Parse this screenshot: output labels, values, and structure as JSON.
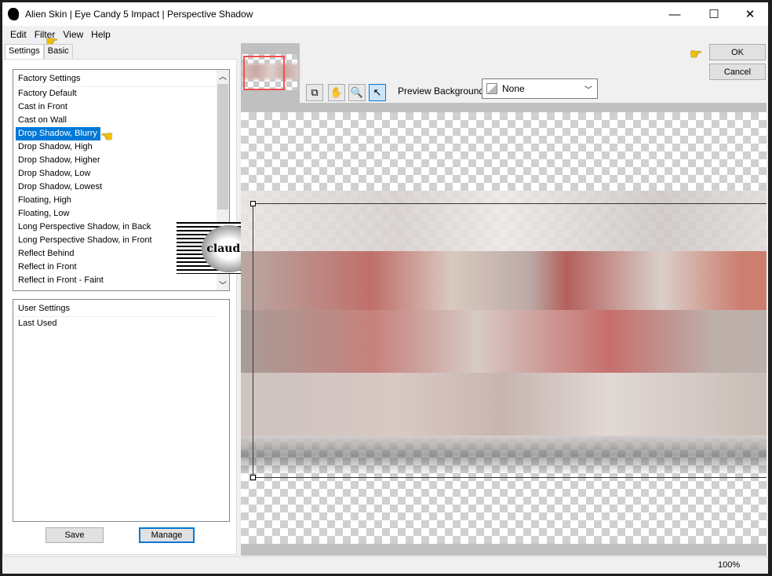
{
  "window": {
    "title": "Alien Skin | Eye Candy 5 Impact | Perspective Shadow",
    "minimize": "—",
    "maximize": "☐",
    "close": "✕"
  },
  "menu": [
    "Edit",
    "Filter",
    "View",
    "Help"
  ],
  "tabs": [
    "Settings",
    "Basic"
  ],
  "factory": {
    "header": "Factory Settings",
    "items": [
      "Factory Default",
      "Cast in Front",
      "Cast on Wall",
      "Drop Shadow, Blurry",
      "Drop Shadow, High",
      "Drop Shadow, Higher",
      "Drop Shadow, Low",
      "Drop Shadow, Lowest",
      "Floating, High",
      "Floating, Low",
      "Long Perspective Shadow, in Back",
      "Long Perspective Shadow, in Front",
      "Reflect Behind",
      "Reflect in Front",
      "Reflect in Front - Faint"
    ],
    "selected": "Drop Shadow, Blurry"
  },
  "user": {
    "header": "User Settings",
    "items": [
      "Last Used"
    ]
  },
  "buttons": {
    "save": "Save",
    "manage": "Manage",
    "ok": "OK",
    "cancel": "Cancel"
  },
  "preview": {
    "label": "Preview Background:",
    "value": "None"
  },
  "status": {
    "zoom": "100%"
  },
  "watermark": "claudia",
  "colors": {
    "selection": "#0078d7",
    "nav_rect": "#f05050"
  }
}
